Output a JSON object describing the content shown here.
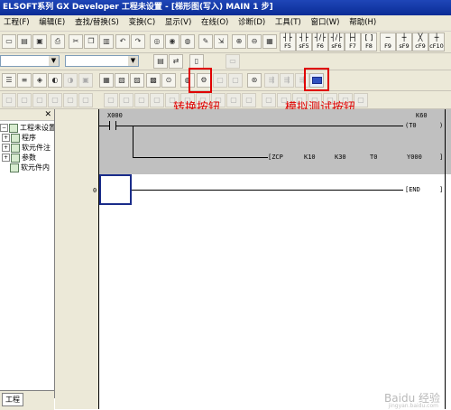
{
  "title": "ELSOFT系列 GX Developer 工程未设置 - [梯形图(写入)      MAIN     1 步]",
  "menu": [
    "工程(F)",
    "编辑(E)",
    "查找/替换(S)",
    "变换(C)",
    "显示(V)",
    "在线(O)",
    "诊断(D)",
    "工具(T)",
    "窗口(W)",
    "帮助(H)"
  ],
  "fkeys": [
    {
      "sym": "┤├",
      "label": "F5"
    },
    {
      "sym": "┤├",
      "label": "sF5"
    },
    {
      "sym": "┤/├",
      "label": "F6"
    },
    {
      "sym": "┤/├",
      "label": "sF6"
    },
    {
      "sym": "├┤",
      "label": "F7"
    },
    {
      "sym": "[ ]",
      "label": "F8"
    },
    {
      "sym": "─",
      "label": "F9"
    },
    {
      "sym": "┼",
      "label": "sF9"
    },
    {
      "sym": "╳",
      "label": "cF9"
    },
    {
      "sym": "┼",
      "label": "cF10"
    }
  ],
  "annotations": {
    "convert": "转换按钮",
    "simulate": "模拟测试按钮"
  },
  "project_tree": {
    "root": "工程未设置",
    "items": [
      "程序",
      "软元件注",
      "参数",
      "软元件内"
    ]
  },
  "bottom_tab": "工程",
  "ladder": {
    "rung1": {
      "step": "",
      "contact": "X000",
      "timer_const": "K60",
      "timer_coil": "(T0",
      "instruction": "[ZCP",
      "op1": "K10",
      "op2": "K30",
      "op3": "T0",
      "op4": "Y000"
    },
    "rung2": {
      "step": "0",
      "end": "[END"
    }
  },
  "watermark": "Baidu 经验",
  "watermark_url": "jingyan.baidu.com"
}
